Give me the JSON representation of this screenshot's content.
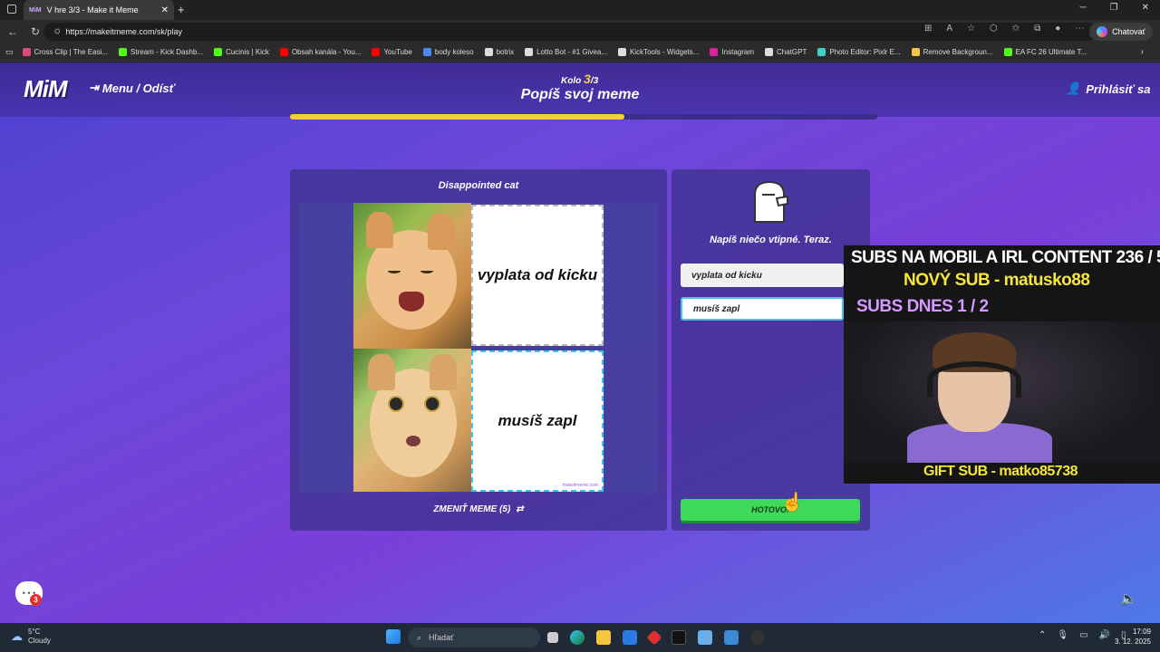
{
  "browser": {
    "tab_title": "V hre 3/3 - Make it Meme",
    "tab_favicon": "MiM",
    "url": "https://makeitmeme.com/sk/play",
    "chat_label": "Chatovať",
    "bookmarks": [
      {
        "label": "Cross Clip | The Easi...",
        "color": "#e04a7a"
      },
      {
        "label": "Stream - Kick Dashb...",
        "color": "#53fc18"
      },
      {
        "label": "Cucinis | Kick",
        "color": "#53fc18"
      },
      {
        "label": "Obsah kanála - You...",
        "color": "#ff0000"
      },
      {
        "label": "YouTube",
        "color": "#ff0000"
      },
      {
        "label": "body koleso",
        "color": "#4a8af4"
      },
      {
        "label": "botrix",
        "color": "#dddddd"
      },
      {
        "label": "Lotto Bot - #1 Givea...",
        "color": "#dddddd"
      },
      {
        "label": "KickTools - Widgets...",
        "color": "#dddddd"
      },
      {
        "label": "Instagram",
        "color": "#d6249f"
      },
      {
        "label": "ChatGPT",
        "color": "#dddddd"
      },
      {
        "label": "Photo Editor: Pixlr E...",
        "color": "#3fd0c6"
      },
      {
        "label": "Remove Backgroun...",
        "color": "#f5c542"
      },
      {
        "label": "EA FC 26 Ultimate T...",
        "color": "#53fc18"
      }
    ]
  },
  "header": {
    "logo": "MiM",
    "menu_label": "Menu / Odísť",
    "round_prefix": "Kolo",
    "round_current": "3",
    "round_total": "/3",
    "title": "Popíš svoj meme",
    "login_label": "Prihlásiť sa",
    "progress": 0.57
  },
  "meme": {
    "title": "Disappointed cat",
    "panel1_text": "vyplata od kicku",
    "panel2_text": "musíš zapl",
    "watermark": "makeitmeme.com",
    "change_label": "ZMENIŤ MEME (5)"
  },
  "right": {
    "prompt": "Napíš niečo vtipné. Teraz.",
    "input1_value": "vyplata od kicku",
    "input2_value": "musíš zapl",
    "done_label": "HOTOVO!"
  },
  "overlay": {
    "line1": "SUBS NA MOBIL A IRL CONTENT  236 / 500",
    "line2": "NOVÝ SUB - matusko88",
    "line3": "SUBS DNES  1 / 2",
    "line4": "GIFT SUB - matko85738"
  },
  "page_icons": {
    "chat_badge": "3"
  },
  "taskbar": {
    "temp": "5°C",
    "weather": "Cloudy",
    "search_placeholder": "Hľadať",
    "time": "17:09",
    "date": "3. 12. 2025"
  }
}
